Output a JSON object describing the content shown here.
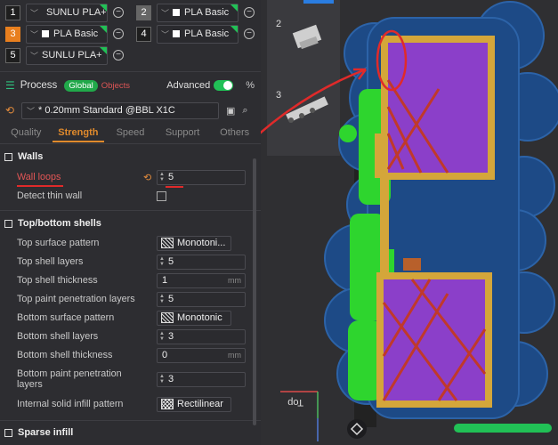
{
  "filaments": [
    {
      "num": "1",
      "name": "SUNLU PLA+",
      "swatch": "#ffffff",
      "num_bg": "#1e1e1e"
    },
    {
      "num": "2",
      "name": "PLA Basic",
      "swatch": "#ffffff",
      "num_bg": "#666666"
    },
    {
      "num": "3",
      "name": "PLA Basic",
      "swatch": "#ffffff",
      "num_bg": "#e87f1e"
    },
    {
      "num": "4",
      "name": "PLA Basic",
      "swatch": "#ffffff",
      "num_bg": "#1e1e1e"
    },
    {
      "num": "5",
      "name": "SUNLU PLA+",
      "swatch": "#ffffff",
      "num_bg": "#1e1e1e"
    }
  ],
  "process": {
    "title": "Process",
    "global_label": "Global",
    "objects_label": "Objects",
    "advanced_label": "Advanced",
    "advanced_on": true,
    "preset": "* 0.20mm Standard @BBL X1C"
  },
  "tabs": [
    "Quality",
    "Strength",
    "Speed",
    "Support",
    "Others"
  ],
  "active_tab": "Strength",
  "sections": {
    "walls": {
      "title": "Walls",
      "wall_loops_label": "Wall loops",
      "wall_loops_value": "5",
      "detect_thin_wall_label": "Detect thin wall"
    },
    "top_bottom": {
      "title": "Top/bottom shells",
      "top_surface_pattern_label": "Top surface pattern",
      "top_surface_pattern_value": "Monotoni...",
      "top_shell_layers_label": "Top shell layers",
      "top_shell_layers_value": "5",
      "top_shell_thickness_label": "Top shell thickness",
      "top_shell_thickness_value": "1",
      "top_paint_label": "Top paint penetration layers",
      "top_paint_value": "5",
      "bottom_surface_pattern_label": "Bottom surface pattern",
      "bottom_surface_pattern_value": "Monotonic",
      "bottom_shell_layers_label": "Bottom shell layers",
      "bottom_shell_layers_value": "3",
      "bottom_shell_thickness_label": "Bottom shell thickness",
      "bottom_shell_thickness_value": "0",
      "bottom_paint_label": "Bottom paint penetration layers",
      "bottom_paint_value": "3",
      "internal_solid_label": "Internal solid infill pattern",
      "internal_solid_value": "Rectilinear",
      "unit_mm": "mm"
    },
    "sparse": {
      "title": "Sparse infill"
    }
  },
  "viewport": {
    "plate_2_label": "2",
    "plate_3_label": "3",
    "top_label": "Top"
  },
  "colors": {
    "accent_orange": "#e08a2c",
    "accent_green": "#21c156",
    "annotation_red": "#e02a2a",
    "wall_gold": "#d4a63a",
    "infill_purple": "#8b3fc9",
    "support_green": "#2fd62f",
    "brim_blue": "#1e4a8a"
  }
}
